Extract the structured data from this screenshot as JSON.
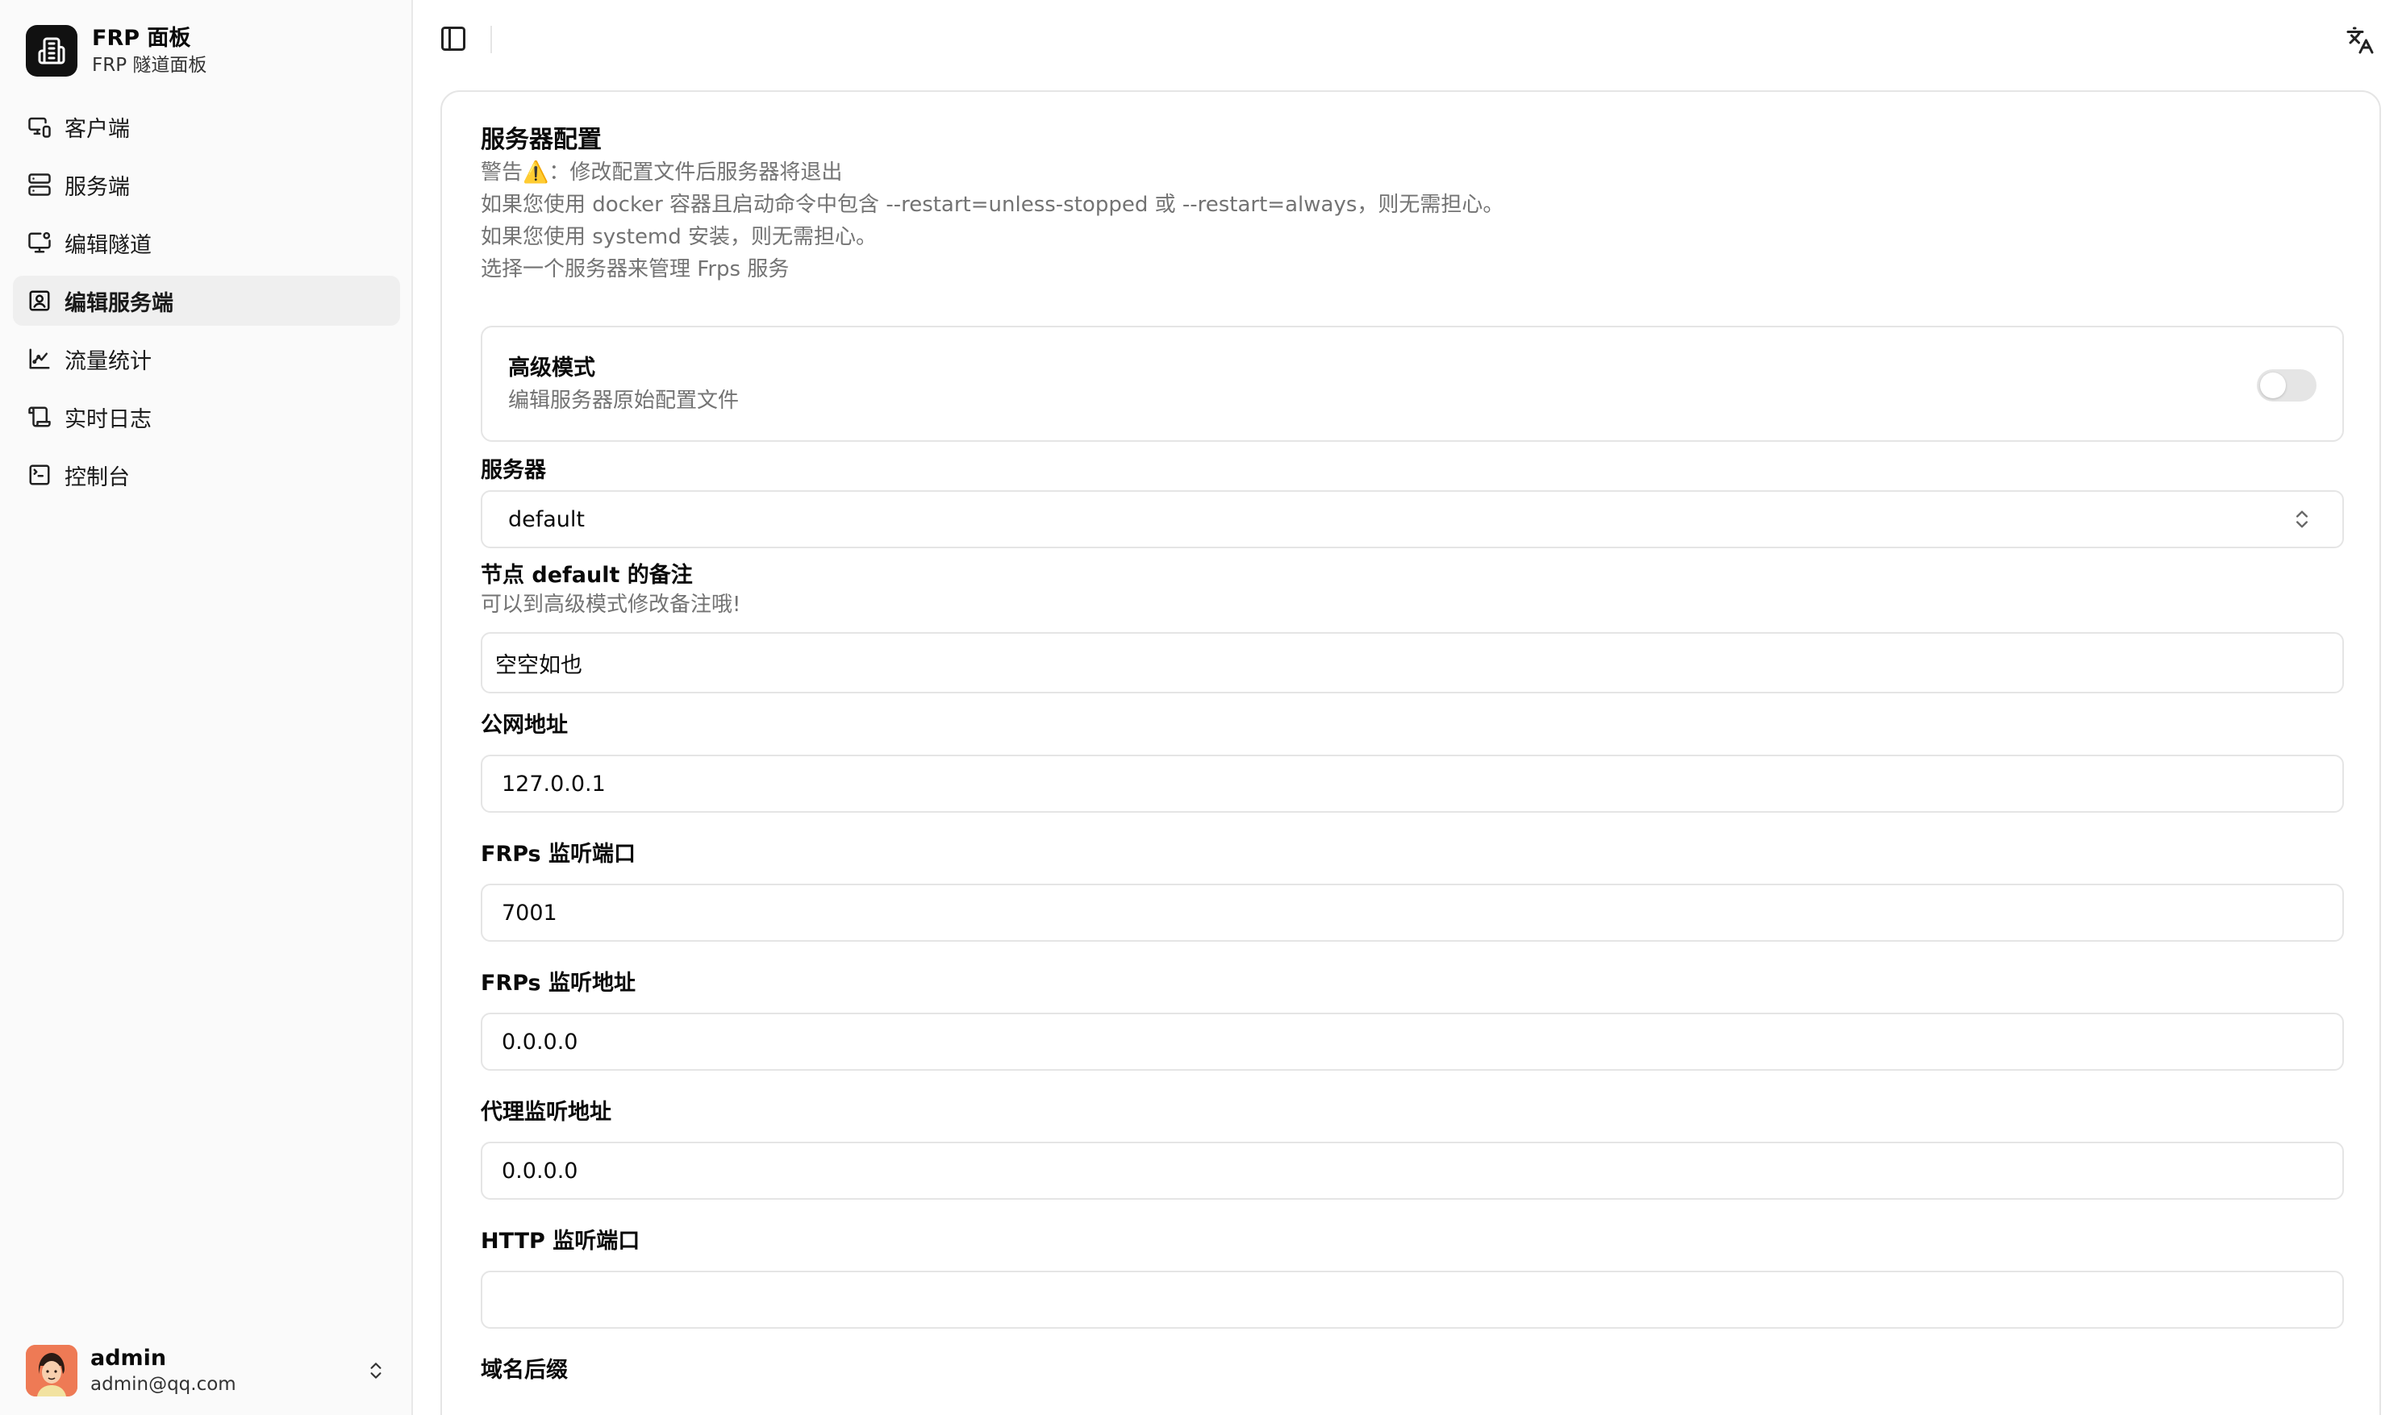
{
  "brand": {
    "title": "FRP  面板",
    "subtitle": "FRP  隧道面板"
  },
  "nav": [
    {
      "label": "客户端",
      "icon": "monitor-smartphone-icon",
      "active": false
    },
    {
      "label": "服务端",
      "icon": "server-icon",
      "active": false
    },
    {
      "label": "编辑隧道",
      "icon": "monitor-cog-icon",
      "active": false
    },
    {
      "label": "编辑服务端",
      "icon": "server-cog-icon",
      "active": true
    },
    {
      "label": "流量统计",
      "icon": "chart-line-icon",
      "active": false
    },
    {
      "label": "实时日志",
      "icon": "scroll-icon",
      "active": false
    },
    {
      "label": "控制台",
      "icon": "terminal-icon",
      "active": false
    }
  ],
  "user": {
    "name": "admin",
    "email": "admin@qq.com"
  },
  "card": {
    "title": "服务器配置",
    "warnings": [
      "警告⚠️：修改配置文件后服务器将退出",
      "如果您使用 docker 容器且启动命令中包含 --restart=unless-stopped 或 --restart=always，则无需担心。",
      "如果您使用 systemd 安装，则无需担心。",
      "选择一个服务器来管理 Frps 服务"
    ],
    "advanced": {
      "title": "高级模式",
      "subtitle": "编辑服务器原始配置文件",
      "enabled": false
    },
    "server": {
      "label": "服务器",
      "value": "default"
    },
    "note": {
      "label": "节点 default 的备注",
      "hint": "可以到高级模式修改备注哦!",
      "value": "空空如也"
    },
    "public_addr": {
      "label": "公网地址",
      "value": "127.0.0.1"
    },
    "frps_port": {
      "label": "FRPs 监听端口",
      "value": "7001"
    },
    "frps_addr": {
      "label": "FRPs 监听地址",
      "value": "0.0.0.0"
    },
    "proxy_addr": {
      "label": "代理监听地址",
      "value": "0.0.0.0"
    },
    "http_port": {
      "label": "HTTP 监听端口",
      "value": ""
    },
    "domain_suffix": {
      "label": "域名后缀"
    }
  }
}
